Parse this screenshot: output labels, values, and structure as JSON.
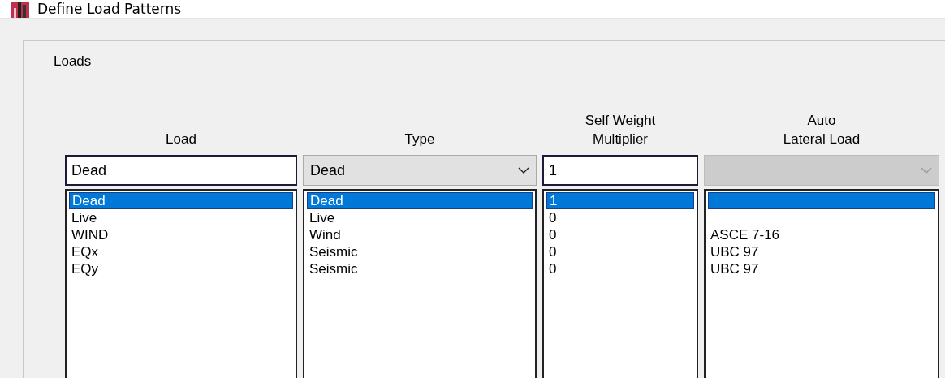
{
  "window": {
    "title": "Define Load Patterns"
  },
  "group": {
    "title": "Loads"
  },
  "columns": [
    {
      "header": [
        "Load"
      ],
      "kind": "text",
      "value": "Dead",
      "disabled": false
    },
    {
      "header": [
        "Type"
      ],
      "kind": "combo",
      "value": "Dead",
      "disabled": false
    },
    {
      "header": [
        "Self Weight",
        "Multiplier"
      ],
      "kind": "text",
      "value": "1",
      "disabled": false
    },
    {
      "header": [
        "Auto",
        "Lateral Load"
      ],
      "kind": "combo",
      "disabled": true
    }
  ],
  "rows": [
    {
      "selected": true,
      "cells": [
        "Dead",
        "Dead",
        "1"
      ]
    },
    {
      "selected": false,
      "cells": [
        "Live",
        "Live",
        "0"
      ]
    },
    {
      "selected": false,
      "cells": [
        "WIND",
        "Wind",
        "0",
        "ASCE 7-16"
      ]
    },
    {
      "selected": false,
      "cells": [
        "EQx",
        "Seismic",
        "0",
        "UBC 97"
      ]
    },
    {
      "selected": false,
      "cells": [
        "EQy",
        "Seismic",
        "0",
        "UBC 97"
      ]
    }
  ]
}
